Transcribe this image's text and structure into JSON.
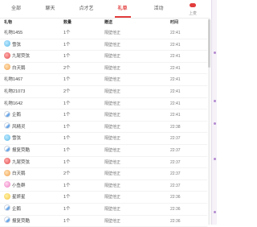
{
  "tabs": [
    {
      "label": "全部",
      "active": false
    },
    {
      "label": "聊天",
      "active": false
    },
    {
      "label": "点才艺",
      "active": false
    },
    {
      "label": "礼单",
      "active": true
    },
    {
      "label": "活动",
      "active": false
    },
    {
      "label": "上麦",
      "active": false
    }
  ],
  "columns": {
    "c1": "礼物",
    "c2": "数量",
    "c3": "赠送",
    "c4": "时间"
  },
  "rows": [
    {
      "gift": "礼物1455",
      "icon": "",
      "qty": "1个",
      "giver": "隔壁他正",
      "time": "22:41"
    },
    {
      "gift": "雪弦",
      "icon": "ghost-gift-icon",
      "qty": "1个",
      "giver": "隔壁他正",
      "time": "22:41"
    },
    {
      "gift": "九尾荧弦",
      "icon": "rose-gift-icon",
      "qty": "1个",
      "giver": "隔壁他正",
      "time": "22:41"
    },
    {
      "gift": "白天鹅",
      "icon": "bag-gift-icon",
      "qty": "2个",
      "giver": "隔壁他正",
      "time": "22:41"
    },
    {
      "gift": "礼物1467",
      "icon": "",
      "qty": "1个",
      "giver": "隔壁他正",
      "time": "22:41"
    },
    {
      "gift": "礼物21073",
      "icon": "",
      "qty": "2个",
      "giver": "隔壁他正",
      "time": "22:41"
    },
    {
      "gift": "礼物1642",
      "icon": "",
      "qty": "1个",
      "giver": "隔壁他正",
      "time": "22:41"
    },
    {
      "gift": "企鹅",
      "icon": "stick-gift-icon",
      "qty": "1个",
      "giver": "隔壁他正",
      "time": "22:41"
    },
    {
      "gift": "风精灵",
      "icon": "stick-gift-icon",
      "qty": "1个",
      "giver": "隔壁他正",
      "time": "22:38"
    },
    {
      "gift": "雪弦",
      "icon": "ghost-gift-icon",
      "qty": "1个",
      "giver": "隔壁他正",
      "time": "22:37"
    },
    {
      "gift": "报复荧酷",
      "icon": "stick-gift-icon",
      "qty": "1个",
      "giver": "隔壁他正",
      "time": "22:37"
    },
    {
      "gift": "九尾荧弦",
      "icon": "rose-gift-icon",
      "qty": "1个",
      "giver": "隔壁他正",
      "time": "22:37"
    },
    {
      "gift": "白天鹅",
      "icon": "bag-gift-icon",
      "qty": "2个",
      "giver": "隔壁他正",
      "time": "22:37"
    },
    {
      "gift": "小鱼群",
      "icon": "fish-gift-icon",
      "qty": "1个",
      "giver": "隔壁他正",
      "time": "22:37"
    },
    {
      "gift": "星妍星",
      "icon": "wand-gift-icon",
      "qty": "1个",
      "giver": "隔壁他正",
      "time": "22:36"
    },
    {
      "gift": "企鹅",
      "icon": "stick-gift-icon",
      "qty": "1个",
      "giver": "隔壁他正",
      "time": "22:36"
    },
    {
      "gift": "报复荧酷",
      "icon": "stick-gift-icon",
      "qty": "1个",
      "giver": "隔壁他正",
      "time": "22:36"
    }
  ],
  "colors": {
    "accent": "#e23c3c",
    "side": "#b48ad0"
  }
}
